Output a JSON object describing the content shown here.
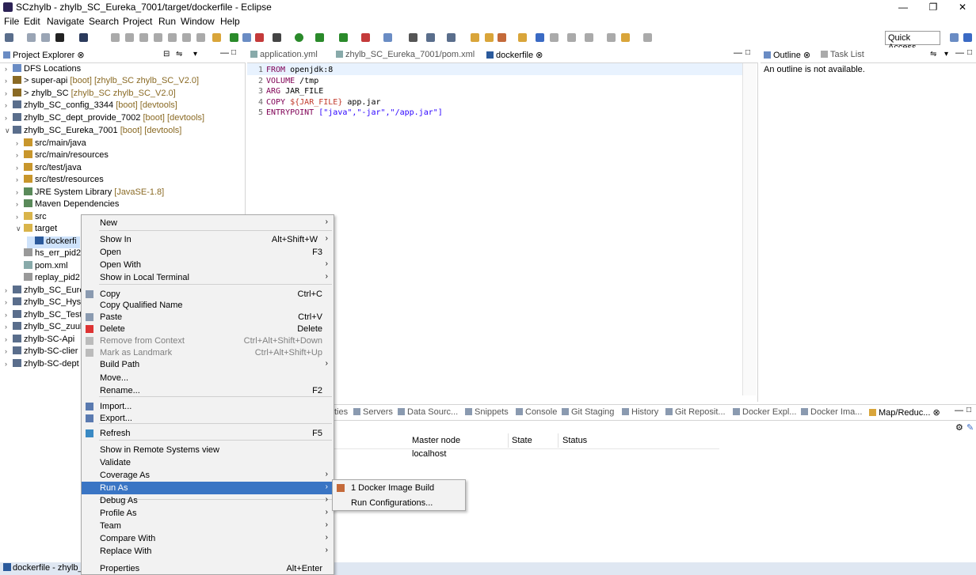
{
  "window": {
    "title": "SCzhylb - zhylb_SC_Eureka_7001/target/dockerfile - Eclipse"
  },
  "menubar": [
    "File",
    "Edit",
    "Navigate",
    "Search",
    "Project",
    "Run",
    "Window",
    "Help"
  ],
  "toolbar": {
    "quick_access": "Quick Access"
  },
  "explorer": {
    "tab": "Project Explorer",
    "items": [
      {
        "label": "DFS Locations",
        "dec": ""
      },
      {
        "label": "> super-api",
        "dec": " [boot] [zhylb_SC zhylb_SC_V2.0]"
      },
      {
        "label": "> zhylb_SC",
        "dec": " [zhylb_SC zhylb_SC_V2.0]"
      },
      {
        "label": "zhylb_SC_config_3344",
        "dec": " [boot] [devtools]"
      },
      {
        "label": "zhylb_SC_dept_provide_7002",
        "dec": " [boot] [devtools]"
      },
      {
        "label": "zhylb_SC_Eureka_7001",
        "dec": " [boot] [devtools]"
      },
      {
        "label": "src/main/java",
        "dec": ""
      },
      {
        "label": "src/main/resources",
        "dec": ""
      },
      {
        "label": "src/test/java",
        "dec": ""
      },
      {
        "label": "src/test/resources",
        "dec": ""
      },
      {
        "label": "JRE System Library",
        "dec": " [JavaSE-1.8]"
      },
      {
        "label": "Maven Dependencies",
        "dec": ""
      },
      {
        "label": "src",
        "dec": ""
      },
      {
        "label": "target",
        "dec": ""
      },
      {
        "label": "dockerfi",
        "dec": ""
      },
      {
        "label": "hs_err_pid2",
        "dec": ""
      },
      {
        "label": "pom.xml",
        "dec": ""
      },
      {
        "label": "replay_pid2",
        "dec": ""
      },
      {
        "label": "zhylb_SC_Eure",
        "dec": ""
      },
      {
        "label": "zhylb_SC_Hyst",
        "dec": ""
      },
      {
        "label": "zhylb_SC_Test",
        "dec": ""
      },
      {
        "label": "zhylb_SC_zuul",
        "dec": ""
      },
      {
        "label": "zhylb-SC-Api",
        "dec": ""
      },
      {
        "label": "zhylb-SC-clier",
        "dec": ""
      },
      {
        "label": "zhylb-SC-dept",
        "dec": ""
      }
    ]
  },
  "editor": {
    "tabs": [
      "application.yml",
      "zhylb_SC_Eureka_7001/pom.xml",
      "dockerfile"
    ],
    "lines": [
      {
        "n": "1",
        "k": "FROM",
        "rest": " openjdk:8"
      },
      {
        "n": "2",
        "k": "VOLUME",
        "rest": " /tmp"
      },
      {
        "n": "3",
        "k": "ARG",
        "rest": " JAR_FILE"
      },
      {
        "n": "4",
        "k": "COPY",
        "v": " ${JAR_FILE}",
        "rest": " app.jar"
      },
      {
        "n": "5",
        "k": "ENTRYPOINT",
        "rest": " [\"java\",\"-jar\",\"/app.jar\"]"
      }
    ]
  },
  "outline": {
    "tabs": [
      "Outline",
      "Task List"
    ],
    "message": "An outline is not available."
  },
  "bottom": {
    "tabs": [
      "ties",
      "Servers",
      "Data Sourc...",
      "Snippets",
      "Console",
      "Git Staging",
      "History",
      "Git Reposit...",
      "Docker Expl...",
      "Docker Ima...",
      "Map/Reduc..."
    ],
    "columns": [
      "Master node",
      "State",
      "Status"
    ],
    "row": [
      "localhost",
      "",
      ""
    ]
  },
  "status": {
    "left": "dockerfile - zhylb_"
  },
  "context_menu": {
    "items": [
      {
        "label": "New",
        "shortcut": "",
        "sub": true
      },
      {
        "label": "Show In",
        "shortcut": "Alt+Shift+W",
        "sub": true
      },
      {
        "label": "Open",
        "shortcut": "F3"
      },
      {
        "label": "Open With",
        "shortcut": "",
        "sub": true
      },
      {
        "label": "Show in Local Terminal",
        "shortcut": "",
        "sub": true
      },
      {
        "label": "Copy",
        "shortcut": "Ctrl+C"
      },
      {
        "label": "Copy Qualified Name",
        "shortcut": ""
      },
      {
        "label": "Paste",
        "shortcut": "Ctrl+V"
      },
      {
        "label": "Delete",
        "shortcut": "Delete"
      },
      {
        "label": "Remove from Context",
        "shortcut": "Ctrl+Alt+Shift+Down",
        "disabled": true
      },
      {
        "label": "Mark as Landmark",
        "shortcut": "Ctrl+Alt+Shift+Up",
        "disabled": true
      },
      {
        "label": "Build Path",
        "shortcut": "",
        "sub": true
      },
      {
        "label": "Move...",
        "shortcut": ""
      },
      {
        "label": "Rename...",
        "shortcut": "F2"
      },
      {
        "label": "Import...",
        "shortcut": ""
      },
      {
        "label": "Export...",
        "shortcut": ""
      },
      {
        "label": "Refresh",
        "shortcut": "F5"
      },
      {
        "label": "Show in Remote Systems view",
        "shortcut": ""
      },
      {
        "label": "Validate",
        "shortcut": ""
      },
      {
        "label": "Coverage As",
        "shortcut": "",
        "sub": true
      },
      {
        "label": "Run As",
        "shortcut": "",
        "sub": true
      },
      {
        "label": "Debug As",
        "shortcut": "",
        "sub": true
      },
      {
        "label": "Profile As",
        "shortcut": "",
        "sub": true
      },
      {
        "label": "Team",
        "shortcut": "",
        "sub": true
      },
      {
        "label": "Compare With",
        "shortcut": "",
        "sub": true
      },
      {
        "label": "Replace With",
        "shortcut": "",
        "sub": true
      },
      {
        "label": "Properties",
        "shortcut": "Alt+Enter"
      }
    ]
  },
  "submenu": {
    "items": [
      "1 Docker Image Build",
      "Run Configurations..."
    ]
  },
  "colors": {
    "highlight": "#3a75c4",
    "status_bar": "#dfe7f2"
  }
}
